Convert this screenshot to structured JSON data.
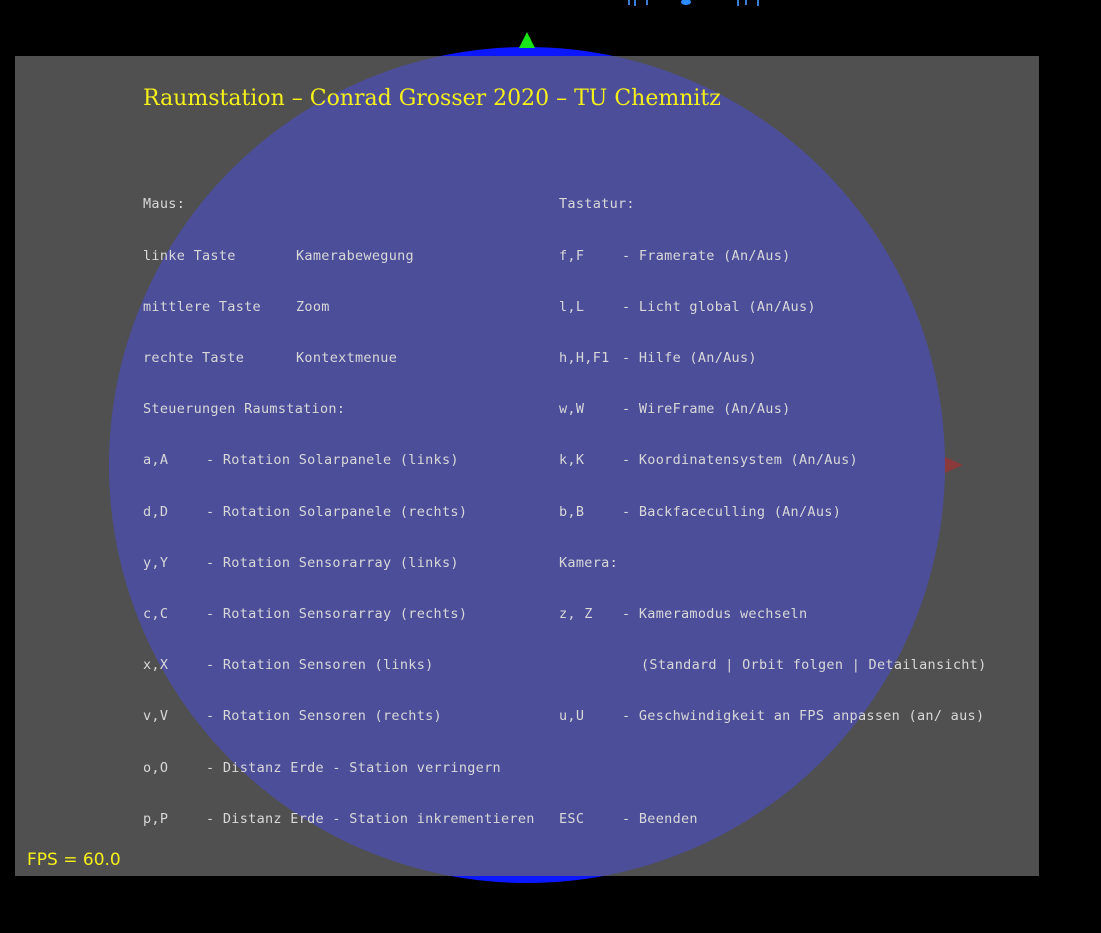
{
  "title": "Raumstation – Conrad Grosser 2020 – TU Chemnitz",
  "fps_label": "FPS = 60.0",
  "colors": {
    "background": "#000000",
    "panel": "#505050",
    "globe": "#4c4e9a",
    "globe_edge": "#0a17ff",
    "title_text": "#f5f01a",
    "help_text": "#d8d8d8",
    "axis_y": "#19e619",
    "axis_x": "#8a3a3a"
  },
  "mouse_section": {
    "heading": "Maus:",
    "rows": [
      {
        "key": "linke Taste",
        "action": "Kamerabewegung"
      },
      {
        "key": "mittlere Taste",
        "action": "Zoom"
      },
      {
        "key": "rechte Taste",
        "action": "Kontextmenue"
      }
    ]
  },
  "station_section": {
    "heading": "Steuerungen Raumstation:",
    "rows": [
      {
        "key": "a,A",
        "action": "- Rotation Solarpanele (links)"
      },
      {
        "key": "d,D",
        "action": "- Rotation Solarpanele (rechts)"
      },
      {
        "key": "y,Y",
        "action": "- Rotation Sensorarray (links)"
      },
      {
        "key": "c,C",
        "action": "- Rotation Sensorarray (rechts)"
      },
      {
        "key": "x,X",
        "action": "- Rotation Sensoren (links)"
      },
      {
        "key": "v,V",
        "action": "- Rotation Sensoren (rechts)"
      },
      {
        "key": "o,O",
        "action": "- Distanz Erde - Station verringern"
      },
      {
        "key": "p,P",
        "action": "- Distanz Erde - Station inkrementieren"
      }
    ]
  },
  "keyboard_section": {
    "heading": "Tastatur:",
    "rows": [
      {
        "key": "f,F",
        "action": "- Framerate (An/Aus)"
      },
      {
        "key": "l,L",
        "action": "- Licht global (An/Aus)"
      },
      {
        "key": "h,H,F1",
        "action": "- Hilfe (An/Aus)"
      },
      {
        "key": "w,W",
        "action": "- WireFrame (An/Aus)"
      },
      {
        "key": "k,K",
        "action": "- Koordinatensystem (An/Aus)"
      },
      {
        "key": "b,B",
        "action": "- Backfaceculling (An/Aus)"
      }
    ]
  },
  "camera_section": {
    "heading": "Kamera:",
    "rows": [
      {
        "key": "z, Z",
        "action": "- Kameramodus wechseln"
      },
      {
        "key": "",
        "action": "(Standard | Orbit folgen | Detailansicht)"
      },
      {
        "key": "u,U",
        "action": "- Geschwindigkeit an FPS anpassen (an/ aus)"
      }
    ]
  },
  "exit_row": {
    "key": "ESC",
    "action": "- Beenden"
  }
}
